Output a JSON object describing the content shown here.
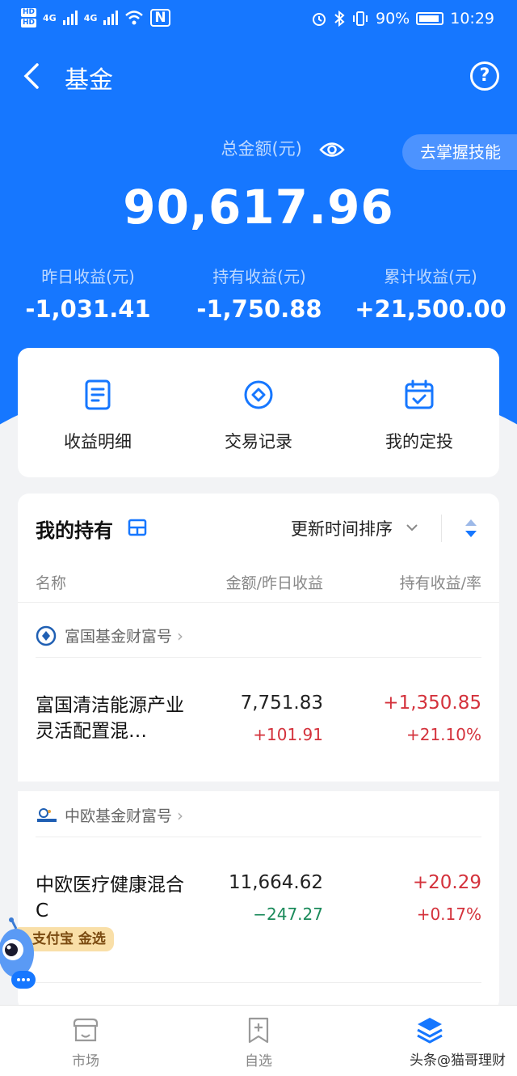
{
  "status_bar": {
    "network": "4G",
    "network2": "4G",
    "nfc": "N",
    "battery": "90%",
    "time": "10:29"
  },
  "nav": {
    "title": "基金",
    "back_icon": "chevron-left-icon",
    "help_icon": "question-circle-icon",
    "help_glyph": "?"
  },
  "summary": {
    "total_label": "总金额(元)",
    "total_value": "90,617.96",
    "skill_tag": "去掌握技能",
    "stats": [
      {
        "label": "昨日收益(元)",
        "value": "-1,031.41"
      },
      {
        "label": "持有收益(元)",
        "value": "-1,750.88"
      },
      {
        "label": "累计收益(元)",
        "value": "+21,500.00"
      }
    ]
  },
  "quick_actions": [
    {
      "label": "收益明细",
      "icon": "document-icon"
    },
    {
      "label": "交易记录",
      "icon": "diamond-circle-icon"
    },
    {
      "label": "我的定投",
      "icon": "calendar-check-icon"
    }
  ],
  "holdings": {
    "title": "我的持有",
    "sort_label": "更新时间排序",
    "columns": [
      "名称",
      "金额/昨日收益",
      "持有收益/率"
    ],
    "groups": [
      {
        "issuer": "富国基金财富号",
        "fund": {
          "name": "富国清洁能源产业灵活配置混…",
          "amount": "7,751.83",
          "yesterday": "+101.91",
          "hold_profit": "+1,350.85",
          "hold_rate": "+21.10%"
        }
      },
      {
        "issuer": "中欧基金财富号",
        "fund": {
          "name": "中欧医疗健康混合C",
          "amount": "11,664.62",
          "yesterday": "−247.27",
          "hold_profit": "+20.29",
          "hold_rate": "+0.17%"
        }
      }
    ],
    "badge": "支付宝 金选"
  },
  "tabbar": [
    {
      "label": "市场",
      "icon": "market-icon"
    },
    {
      "label": "自选",
      "icon": "add-favorite-icon"
    },
    {
      "label": "",
      "icon": "layers-icon"
    }
  ],
  "watermark": "头条@猫哥理财",
  "colors": {
    "brand": "#1677ff",
    "up": "#d4323c",
    "down": "#1a8a5a"
  }
}
